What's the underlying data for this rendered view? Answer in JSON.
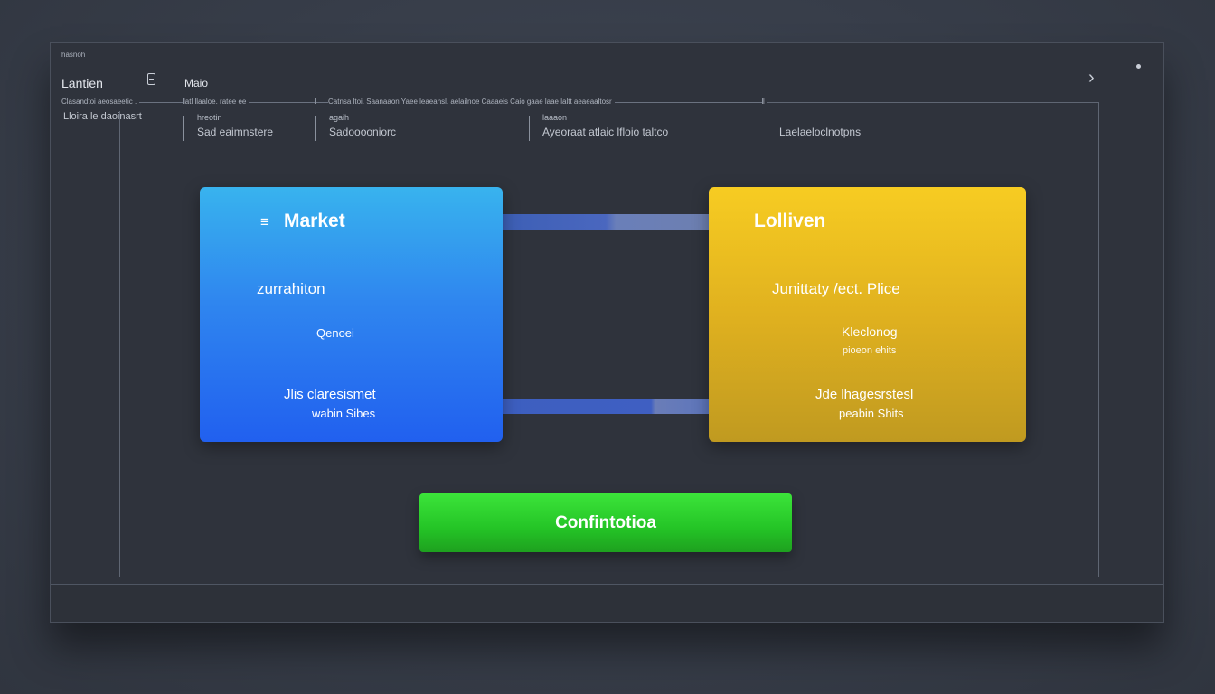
{
  "window": {
    "top_tiny_label": "hasnoh",
    "title": "Lantien",
    "title_icon": "document-icon",
    "subtitle": "Maio",
    "nav_icon": "chevron-right-icon",
    "status_icon": "dot-icon"
  },
  "ruler": {
    "seg1": "Clasandtoi aeosaeetic .",
    "seg2": "latl llaaloe.  ratee ee",
    "seg3": "Catnsa ltoi. Saanaaon  Yaee leaeahsl. aelailnoe Caaaeis Caio gaae laae laltt aeaeaaltosr",
    "seg4": "l"
  },
  "columns": [
    {
      "label": "",
      "value": "Lloira le daoinasrt"
    },
    {
      "label": "hreotin",
      "value": "Sad eaimnstere"
    },
    {
      "label": "agaih",
      "value": "Sadooooniorc"
    },
    {
      "label": "laaaon",
      "value": "Ayeoraat atlaic lfloio taltco"
    },
    {
      "label": "",
      "value": "Laelaeloclnotpns"
    }
  ],
  "cards": {
    "market": {
      "icon": "list-icon",
      "title": "Market",
      "line1": "zurrahiton",
      "line2": "Qenoei",
      "line3": "Jlis claresismet",
      "line4": "wabin Sibes"
    },
    "lolliven": {
      "title": "Lolliven",
      "line1": "Junittaty /ect. Plice",
      "line2": "Kleclonog",
      "line2b": "pioeon ehits",
      "line3": "Jde  lhagesrstesl",
      "line4": "peabin Shits"
    }
  },
  "confirm_label": "Confintotioa"
}
